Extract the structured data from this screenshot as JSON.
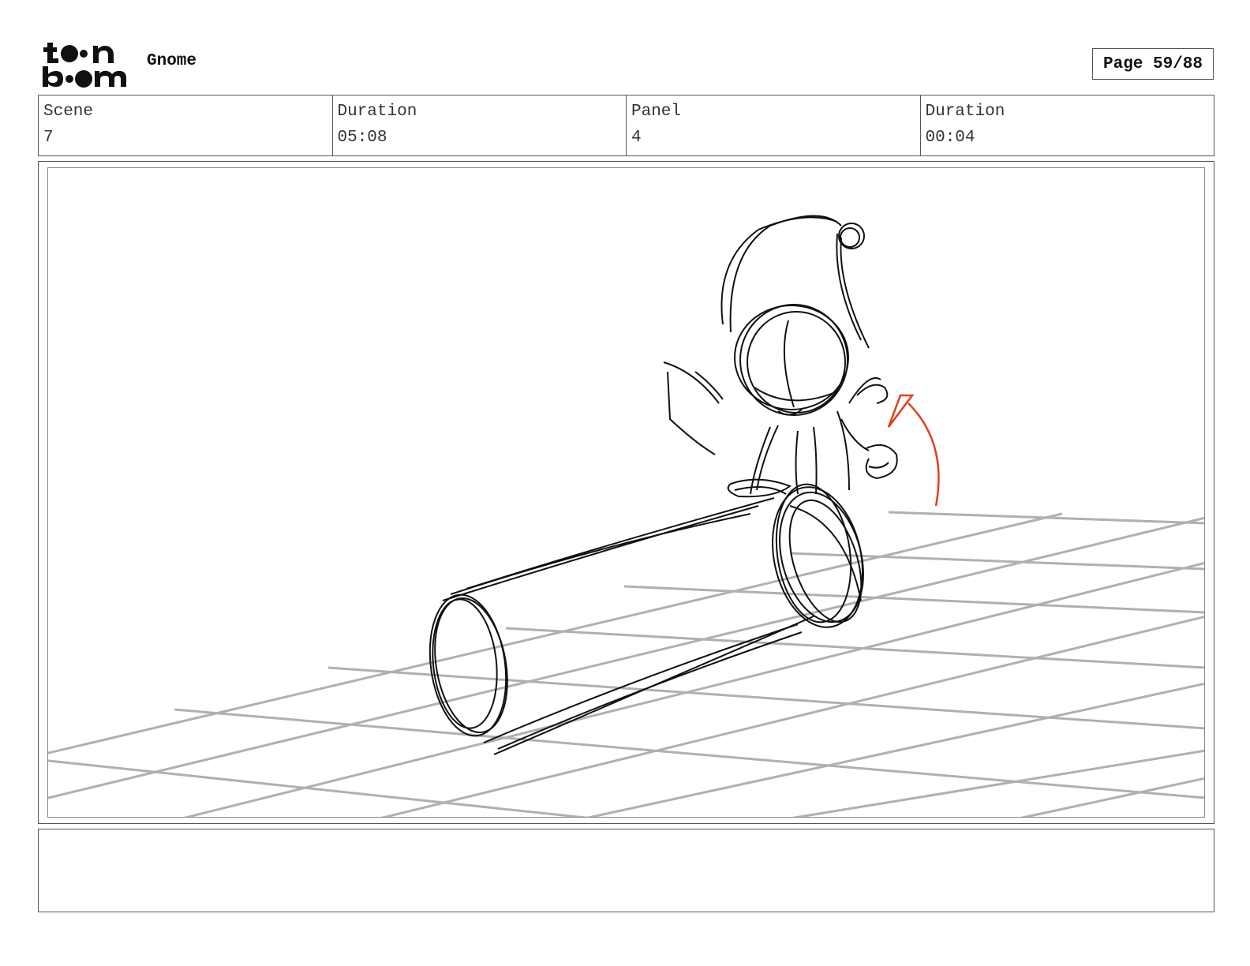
{
  "header": {
    "logo_top": "t●●n",
    "logo_bottom": "b●●m",
    "project_title": "Gnome",
    "page_label": "Page 59/88"
  },
  "info": {
    "scene_label": "Scene",
    "scene_value": "7",
    "scene_duration_label": "Duration",
    "scene_duration_value": "05:08",
    "panel_label": "Panel",
    "panel_value": "4",
    "panel_duration_label": "Duration",
    "panel_duration_value": "00:04"
  },
  "notes": {
    "text": ""
  },
  "colors": {
    "sketch": "#111111",
    "grid": "#b0b0b0",
    "arrow": "#e0401c"
  }
}
